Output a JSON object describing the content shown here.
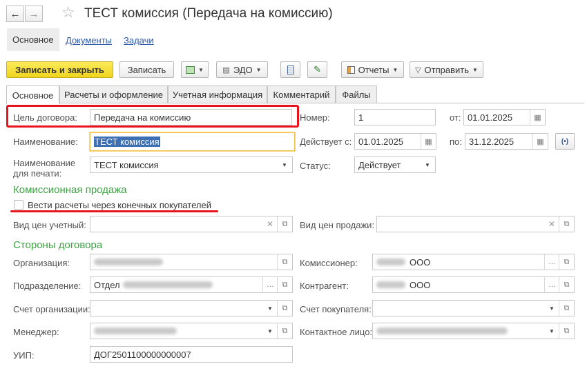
{
  "window": {
    "title": "ТЕСТ комиссия (Передача на комиссию)"
  },
  "nav_tabs": [
    {
      "label": "Основное"
    },
    {
      "label": "Документы"
    },
    {
      "label": "Задачи"
    }
  ],
  "toolbar": {
    "save_close_label": "Записать и закрыть",
    "save_label": "Записать",
    "edo_label": "ЭДО",
    "reports_label": "Отчеты",
    "send_label": "Отправить"
  },
  "page_tabs": [
    {
      "label": "Основное"
    },
    {
      "label": "Расчеты и оформление"
    },
    {
      "label": "Учетная информация"
    },
    {
      "label": "Комментарий"
    },
    {
      "label": "Файлы"
    }
  ],
  "form": {
    "purpose_label": "Цель договора:",
    "purpose_value": "Передача на комиссию",
    "name_label": "Наименование:",
    "name_value": "ТЕСТ комиссия",
    "print_name_label_1": "Наименование",
    "print_name_label_2": "для печати:",
    "print_name_value": "ТЕСТ комиссия",
    "number_label": "Номер:",
    "number_value": "1",
    "from_label": "от:",
    "from_value": "01.01.2025",
    "valid_label": "Действует с:",
    "valid_from_value": "01.01.2025",
    "to_label": "по:",
    "to_value": "31.12.2025",
    "status_label": "Статус:",
    "status_value": "Действует",
    "commission_section": "Комиссионная продажа",
    "end_buyers_label": "Вести расчеты через конечных покупателей",
    "price_type_label": "Вид цен учетный:",
    "sale_price_type_label": "Вид цен продажи:",
    "parties_section": "Стороны договора",
    "organization_label": "Организация:",
    "commissioner_label": "Комиссионер:",
    "commissioner_value": "ООО",
    "department_label": "Подразделение:",
    "department_value": "Отдел",
    "counterparty_label": "Контрагент:",
    "counterparty_value": "ООО",
    "org_account_label": "Счет организации:",
    "buyer_account_label": "Счет покупателя:",
    "manager_label": "Менеджер:",
    "contact_label": "Контактное лицо:",
    "uip_label": "УИП:",
    "uip_value": "ДОГ2501100000000007"
  },
  "colors": {
    "primary_button": "#f3d92b",
    "section_title": "#3aa340",
    "link": "#2a58ad",
    "highlight": "#e8131c"
  },
  "icons": [
    "back-arrow-icon",
    "forward-arrow-icon",
    "favorite-star-icon",
    "calendar-icon",
    "open-icon",
    "clear-icon",
    "dropdown-icon",
    "more-icon"
  ]
}
